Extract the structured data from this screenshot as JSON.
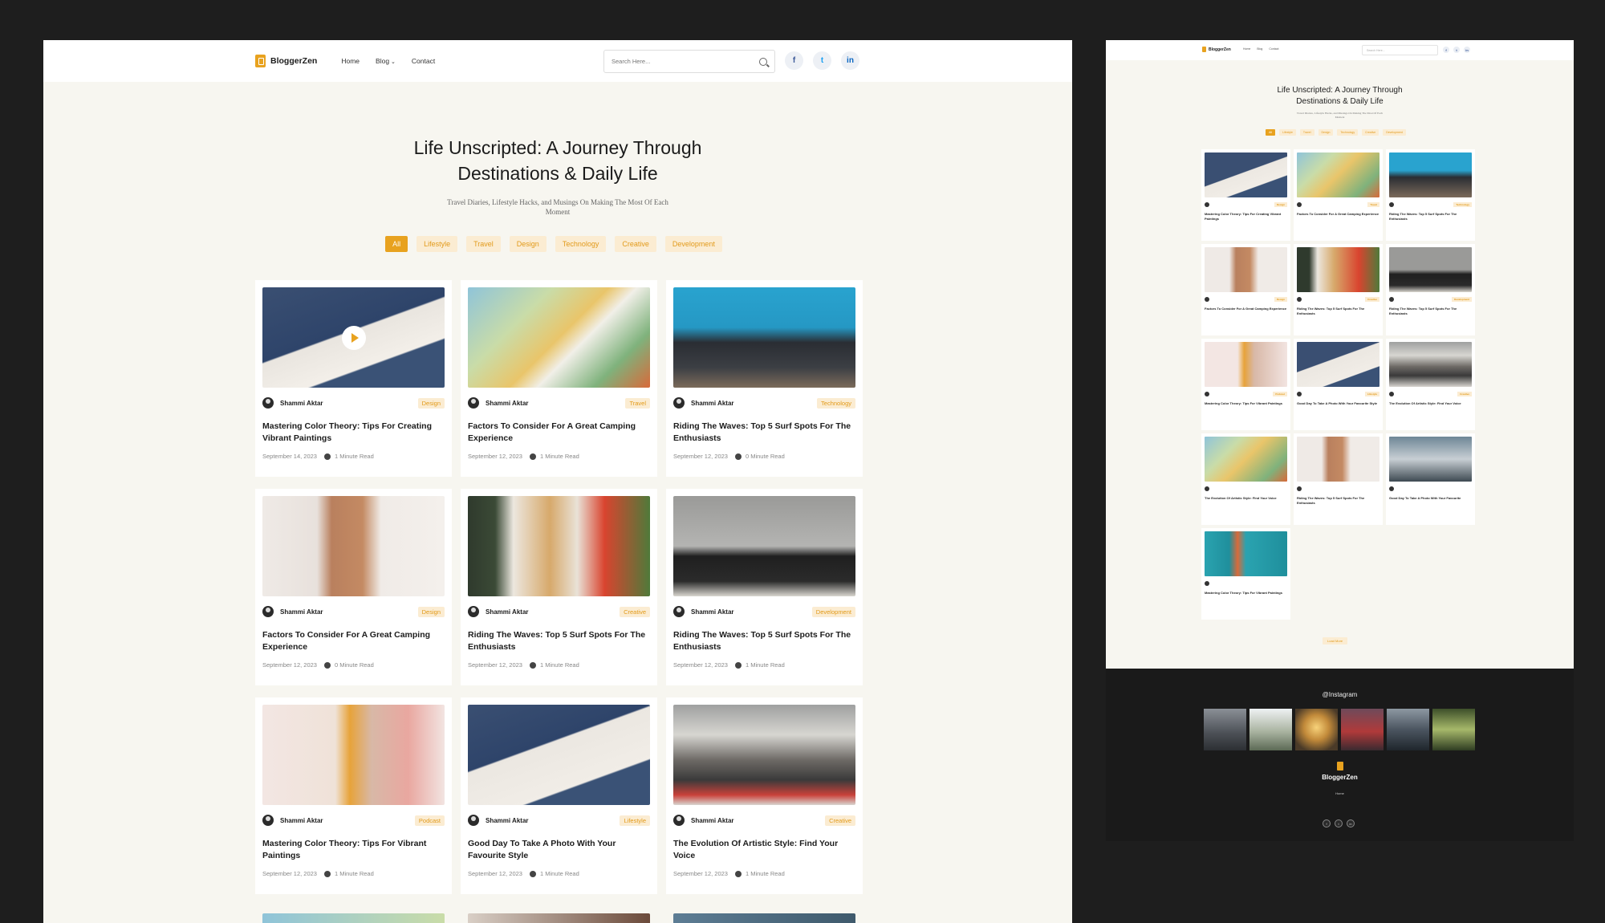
{
  "brand": {
    "name": "BloggerZen",
    "accent": "#e8a21f"
  },
  "nav": {
    "items": [
      "Home",
      "Blog",
      "Contact"
    ]
  },
  "search": {
    "placeholder": "Search Here..."
  },
  "socials": [
    "facebook-icon",
    "twitter-icon",
    "linkedin-icon"
  ],
  "hero": {
    "title": "Life Unscripted: A Journey Through Destinations & Daily Life",
    "subtitle": "Travel Diaries, Lifestyle Hacks, and Musings On Making The Most Of Each Moment"
  },
  "filters": [
    "All",
    "Lifestyle",
    "Travel",
    "Design",
    "Technology",
    "Creative",
    "Development"
  ],
  "cards": [
    {
      "author": "Shammi Aktar",
      "category": "Design",
      "title": "Mastering Color Theory: Tips For Creating Vibrant Paintings",
      "date": "September 14, 2023",
      "read": "1 Minute Read"
    },
    {
      "author": "Shammi Aktar",
      "category": "Travel",
      "title": "Factors To Consider For A Great Camping Experience",
      "date": "September 12, 2023",
      "read": "1 Minute Read"
    },
    {
      "author": "Shammi Aktar",
      "category": "Technology",
      "title": "Riding The Waves: Top 5 Surf Spots For The Enthusiasts",
      "date": "September 12, 2023",
      "read": "0 Minute Read"
    },
    {
      "author": "Shammi Aktar",
      "category": "Design",
      "title": "Factors To Consider For A Great Camping Experience",
      "date": "September 12, 2023",
      "read": "0 Minute Read"
    },
    {
      "author": "Shammi Aktar",
      "category": "Creative",
      "title": "Riding The Waves: Top 5 Surf Spots For The Enthusiasts",
      "date": "September 12, 2023",
      "read": "1 Minute Read"
    },
    {
      "author": "Shammi Aktar",
      "category": "Development",
      "title": "Riding The Waves: Top 5 Surf Spots For The Enthusiasts",
      "date": "September 12, 2023",
      "read": "1 Minute Read"
    },
    {
      "author": "Shammi Aktar",
      "category": "Podcast",
      "title": "Mastering Color Theory: Tips For Vibrant Paintings",
      "date": "September 12, 2023",
      "read": "1 Minute Read"
    },
    {
      "author": "Shammi Aktar",
      "category": "Lifestyle",
      "title": "Good Day To Take A Photo With Your Favourite Style",
      "date": "September 12, 2023",
      "read": "1 Minute Read"
    },
    {
      "author": "Shammi Aktar",
      "category": "Creative",
      "title": "The Evolution Of Artistic Style: Find Your Voice",
      "date": "September 12, 2023",
      "read": "1 Minute Read"
    }
  ],
  "mini": {
    "title": "Life Unscripted: A Journey Through Destinations & Daily Life",
    "cards": [
      "Mastering Color Theory: Tips For Creating Vibrant Paintings",
      "Factors To Consider For A Great Camping Experience",
      "Riding The Waves: Top 5 Surf Spots For The Enthusiasts",
      "Factors To Consider For A Great Camping Experience",
      "Riding The Waves: Top 5 Surf Spots For The Enthusiasts",
      "Riding The Waves: Top 5 Surf Spots For The Enthusiasts",
      "Mastering Color Theory: Tips For Vibrant Paintings",
      "Good Day To Take A Photo With Your Favourite Style",
      "The Evolution Of Artistic Style: Find Your Voice",
      "The Evolution Of Artistic Style: Find Your Voice",
      "Riding The Waves: Top 5 Surf Spots For The Enthusiasts",
      "Good Day To Take A Photo With Your Favourite",
      "Mastering Color Theory: Tips For Vibrant Paintings"
    ]
  },
  "footer": {
    "instagram": "@Instagram",
    "brand": "BloggerZen"
  }
}
